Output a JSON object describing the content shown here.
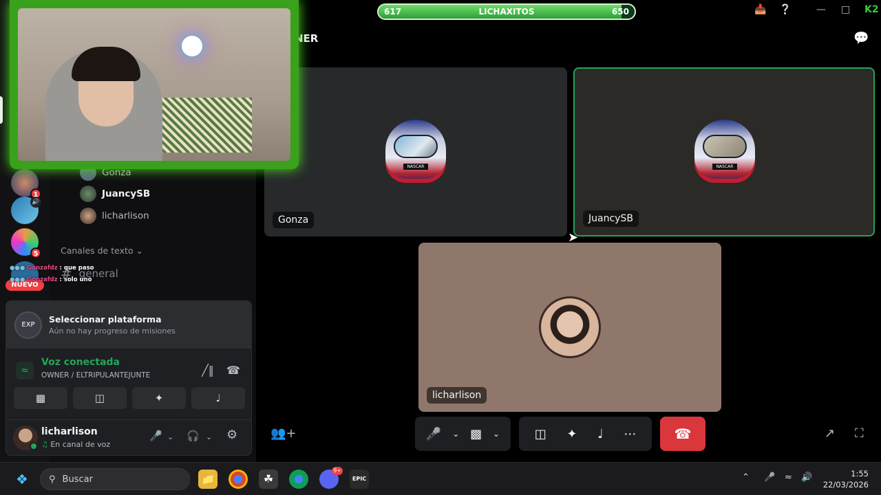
{
  "xp_bar": {
    "left_value": "617",
    "title": "LICHAXITOS",
    "right_value": "650",
    "progress": 0.95
  },
  "stage": {
    "title": "NER"
  },
  "sidebar": {
    "voice_users": [
      {
        "name": "Gonza"
      },
      {
        "name": "JuancySB"
      },
      {
        "name": "licharlison"
      }
    ],
    "category": "Canales de texto",
    "channel": "general",
    "servers": [
      {
        "badge": "1"
      },
      {
        "badge": ""
      },
      {
        "badge": "5"
      }
    ]
  },
  "chat_overlay": [
    {
      "name": "Gonzafdz",
      "text": ": que paso"
    },
    {
      "name": "Gonzafdz",
      "text": ": solo uno"
    }
  ],
  "nuevo_label": "NUEVO",
  "quest": {
    "title": "Seleccionar plataforma",
    "subtitle": "Aún no hay progreso de misiones"
  },
  "voice": {
    "status": "Voz conectada",
    "channel": "OWNER / ELTRIPULANTEJUNTE"
  },
  "user": {
    "name": "licharlison",
    "status": "En canal de voz"
  },
  "tiles": [
    {
      "name": "Gonza"
    },
    {
      "name": "JuancySB"
    },
    {
      "name": "licharlison"
    }
  ],
  "taskbar": {
    "search_placeholder": "Buscar",
    "time": "1:55",
    "date": "22/03/2026",
    "discord_badge": "9+"
  },
  "colors": {
    "voice_green": "#23a55a",
    "hangup_red": "#da373c",
    "cam_border": "#3aa11c"
  }
}
